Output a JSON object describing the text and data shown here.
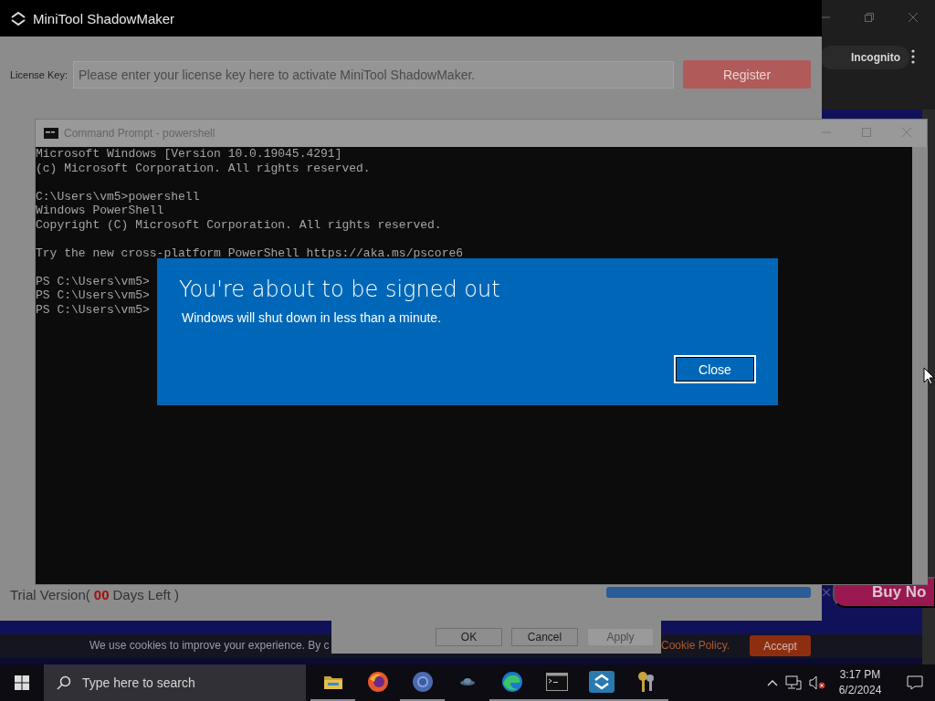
{
  "browser": {
    "badge": "Incognito",
    "promo_button": "Buy No",
    "cookie_bar": {
      "text": "We use cookies to improve your experience. By c",
      "link": "Cookie Policy.",
      "accept": "Accept"
    }
  },
  "shadowmaker": {
    "title": "MiniTool ShadowMaker",
    "license_label": "License Key:",
    "license_placeholder": "Please enter your license key here to activate MiniTool ShadowMaker.",
    "register": "Register",
    "trial_prefix": "Trial Version(",
    "trial_days": "00",
    "trial_suffix": "Days Left )"
  },
  "settings_dialog": {
    "buttons": [
      {
        "label": "OK",
        "disabled": false
      },
      {
        "label": "Cancel",
        "disabled": false
      },
      {
        "label": "Apply",
        "disabled": true
      }
    ]
  },
  "console": {
    "title": "Command Prompt - powershell",
    "blocks": [
      [
        "Microsoft Windows [Version 10.0.19045.4291]",
        "(c) Microsoft Corporation. All rights reserved."
      ],
      [
        "C:\\Users\\vm5>powershell",
        "Windows PowerShell",
        "Copyright (C) Microsoft Corporation. All rights reserved."
      ],
      [
        "Try the new cross-platform PowerShell https://aka.ms/pscore6"
      ],
      [
        "PS C:\\Users\\vm5>",
        "PS C:\\Users\\vm5>",
        "PS C:\\Users\\vm5>"
      ]
    ]
  },
  "signout": {
    "title": "You're about to be signed out",
    "message": "Windows will shut down in less than a minute.",
    "button": "Close"
  },
  "taskbar": {
    "search_placeholder": "Type here to search",
    "apps": [
      {
        "kind": "explorer",
        "running": true
      },
      {
        "kind": "firefox",
        "running": false
      },
      {
        "kind": "chrome",
        "running": true
      },
      {
        "kind": "small",
        "running": false
      },
      {
        "kind": "edge",
        "running": true
      },
      {
        "kind": "terminal",
        "running": true
      },
      {
        "kind": "minitool",
        "running": true
      },
      {
        "kind": "keys",
        "running": true
      }
    ],
    "time": "3:17 PM",
    "date": "6/2/2024"
  }
}
